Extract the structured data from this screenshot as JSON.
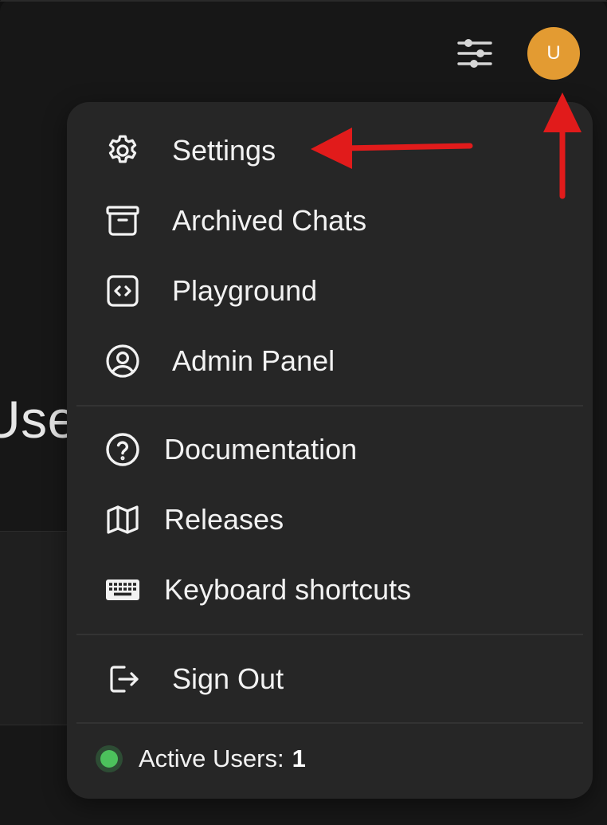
{
  "background": {
    "heading_fragment": "Use"
  },
  "header": {
    "controls_icon": "sliders-icon",
    "avatar_initial": "U",
    "avatar_color": "#e39b32"
  },
  "menu": {
    "items_top": [
      {
        "name": "settings",
        "label": "Settings",
        "icon": "gear-icon"
      },
      {
        "name": "archived-chats",
        "label": "Archived Chats",
        "icon": "archive-box-icon"
      },
      {
        "name": "playground",
        "label": "Playground",
        "icon": "code-bracket-square-icon"
      },
      {
        "name": "admin-panel",
        "label": "Admin Panel",
        "icon": "user-circle-icon"
      }
    ],
    "items_help": [
      {
        "name": "documentation",
        "label": "Documentation",
        "icon": "question-circle-icon"
      },
      {
        "name": "releases",
        "label": "Releases",
        "icon": "map-icon"
      },
      {
        "name": "keyboard-shortcuts",
        "label": "Keyboard shortcuts",
        "icon": "keyboard-icon"
      }
    ],
    "sign_out": {
      "label": "Sign Out",
      "icon": "sign-out-icon"
    },
    "active_users": {
      "label": "Active Users:",
      "count": "1",
      "status_color": "#4cc15c"
    }
  },
  "annotations": {
    "arrow_color": "#e11b1b"
  }
}
